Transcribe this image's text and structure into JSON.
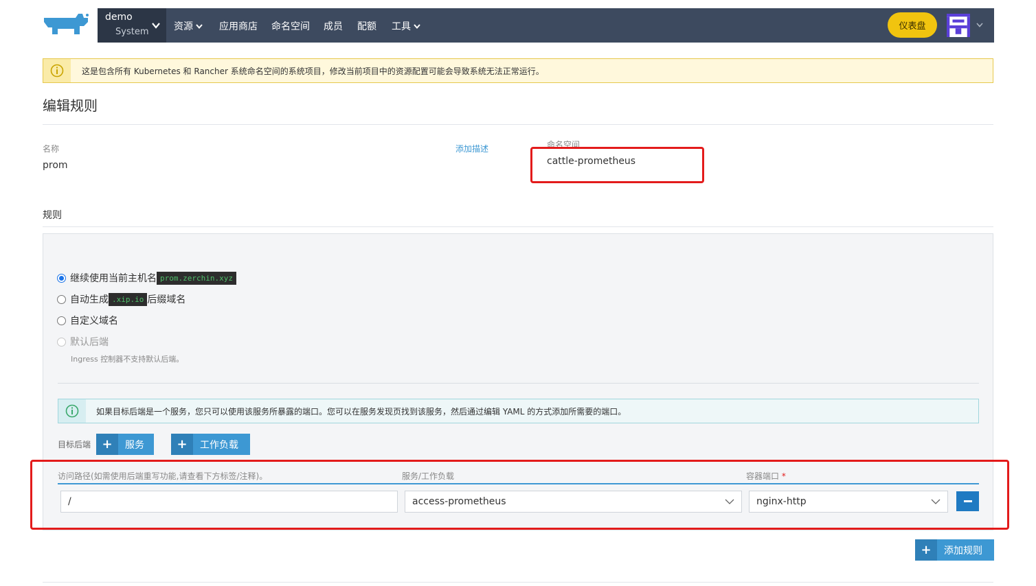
{
  "header": {
    "project_name": "demo",
    "project_cluster": "System",
    "nav": [
      "资源",
      "应用商店",
      "命名空间",
      "成员",
      "配额",
      "工具"
    ],
    "dashboard_label": "仪表盘",
    "colors": {
      "topbar": "#3d4a5f",
      "accent": "#f1c40f",
      "logo": "#3d98d3"
    }
  },
  "warning": {
    "text": "这是包含所有 Kubernetes 和 Rancher 系统命名空间的系统项目，修改当前项目中的资源配置可能会导致系统无法正常运行。"
  },
  "page": {
    "title": "编辑规则",
    "name_label": "名称",
    "name_value": "prom",
    "add_description": "添加描述",
    "namespace_label": "命名空间",
    "namespace_value": "cattle-prometheus",
    "rules_heading": "规则"
  },
  "rule": {
    "options": [
      {
        "label": "继续使用当前主机名",
        "code": "prom.zerchin.xyz",
        "selected": true
      },
      {
        "label": "自动生成",
        "code": ".xip.io",
        "suffix": "后缀域名",
        "selected": false
      },
      {
        "label": "自定义域名",
        "selected": false
      },
      {
        "label": "默认后端",
        "selected": false,
        "disabled": true
      }
    ],
    "ingress_hint": "Ingress 控制器不支持默认后端。",
    "info_text": "如果目标后端是一个服务，您只可以使用该服务所暴露的端口。您可以在服务发现页找到该服务，然后通过编辑 YAML 的方式添加所需要的端口。",
    "target_label": "目标后端",
    "add_service": "服务",
    "add_workload": "工作负载",
    "columns": {
      "path": "访问路径(如需使用后端重写功能,请查看下方标签/注释)。",
      "target": "服务/工作负载",
      "port": "容器端口",
      "required_mark": "*"
    },
    "row": {
      "path": "/",
      "target": "access-prometheus",
      "port": "nginx-http"
    },
    "add_rule": "添加规则"
  }
}
